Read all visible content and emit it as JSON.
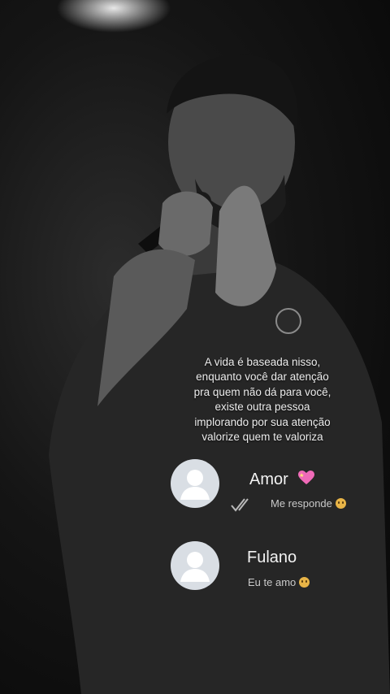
{
  "caption": {
    "lines": [
      "A vida é baseada nisso,",
      "enquanto você dar atenção",
      "pra quem não dá para você,",
      "existe outra pessoa",
      "implorando por sua atenção",
      "valorize quem te valoriza"
    ]
  },
  "chats": [
    {
      "name": "Amor",
      "message": "Me responde",
      "name_icon": "sparkling-heart-icon",
      "message_icon": "pleading-face-icon",
      "status_icon": "double-check-icon"
    },
    {
      "name": "Fulano",
      "message": "Eu te amo",
      "message_icon": "pleading-face-icon"
    }
  ],
  "colors": {
    "heart": "#f06ab8",
    "emoji": "#e8b447",
    "avatar_bg": "#d9dee4",
    "avatar_figure": "#ffffff"
  }
}
